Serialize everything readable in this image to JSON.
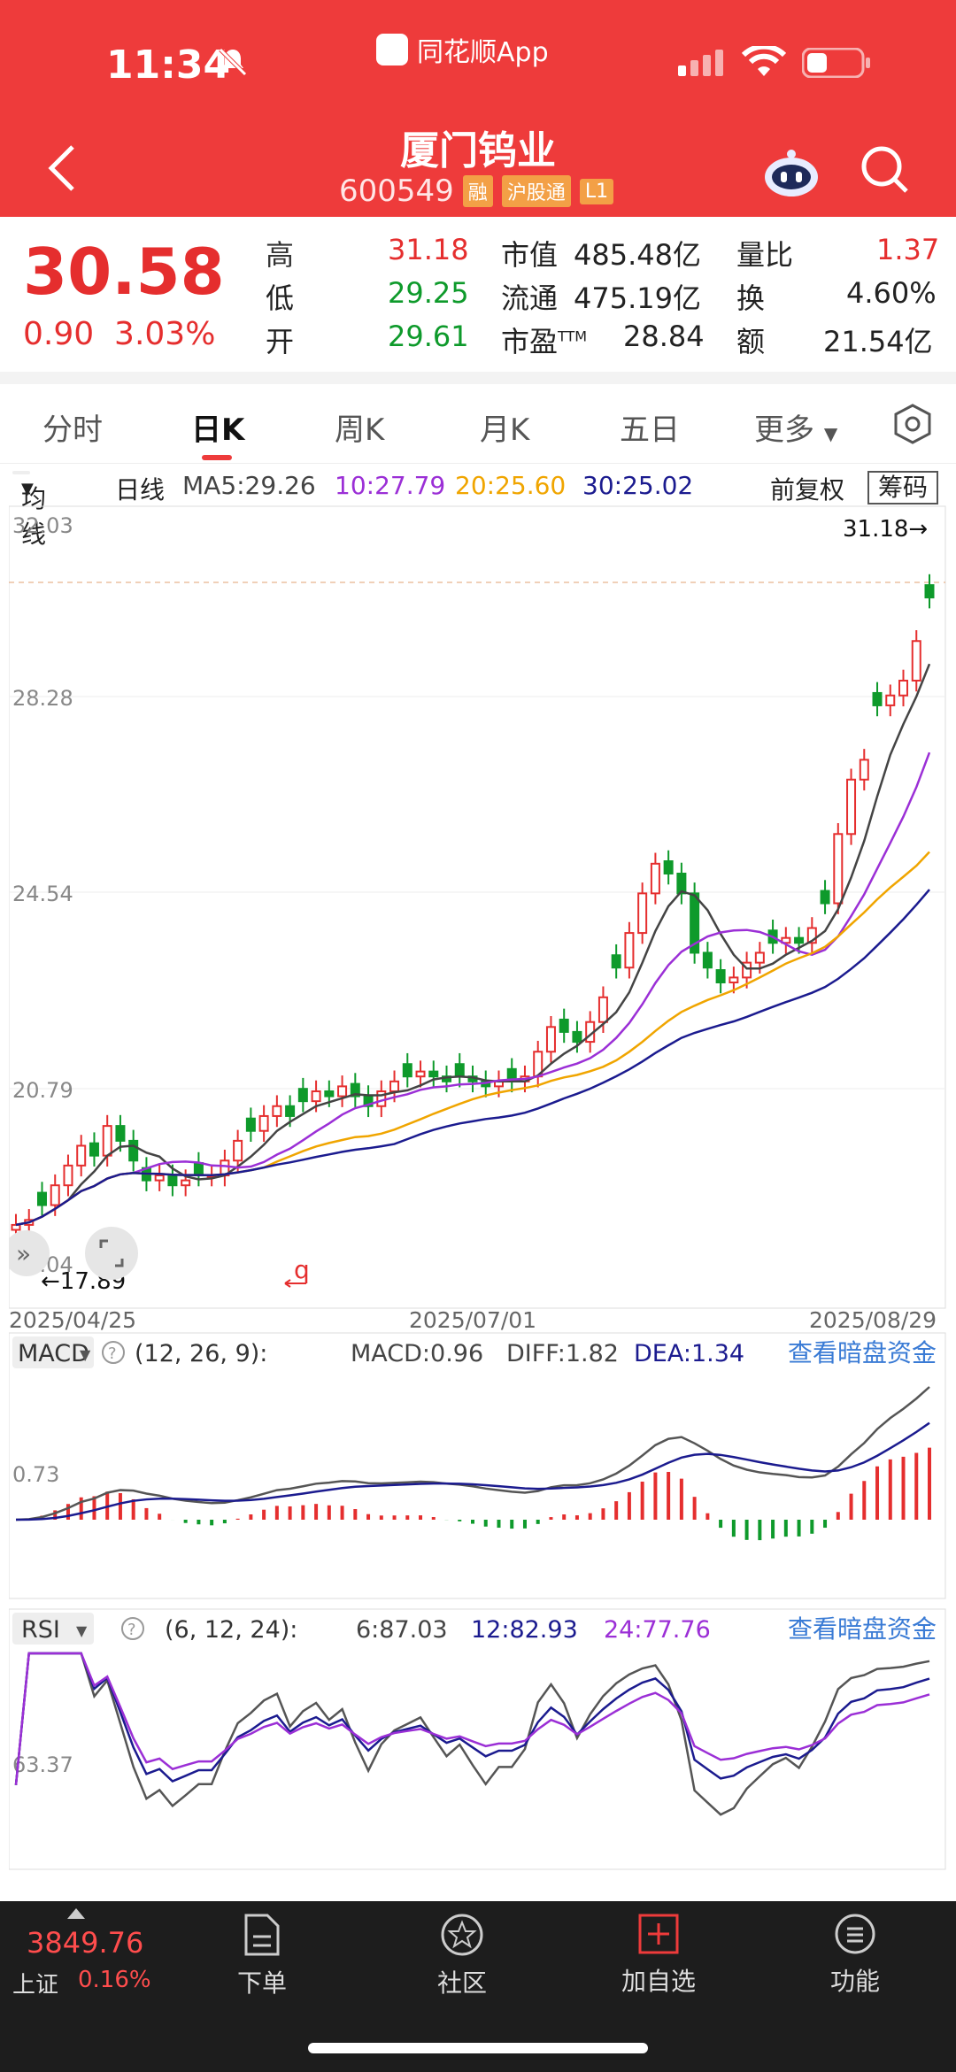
{
  "status": {
    "time": "11:34",
    "app": "同花顺App"
  },
  "header": {
    "title": "厦门钨业",
    "code": "600549",
    "tags": [
      "融",
      "沪股通",
      "L1"
    ]
  },
  "quote": {
    "price": "30.58",
    "change": "0.90",
    "change_pct": "3.03%",
    "rows": [
      {
        "label": "高",
        "value": "31.18",
        "color": "red"
      },
      {
        "label": "低",
        "value": "29.25",
        "color": "green"
      },
      {
        "label": "开",
        "value": "29.61",
        "color": "green"
      }
    ],
    "mid": [
      {
        "label": "市值",
        "value": "485.48亿"
      },
      {
        "label": "流通",
        "value": "475.19亿"
      },
      {
        "label": "市盈",
        "sup": "TTM",
        "value": "28.84"
      }
    ],
    "right": [
      {
        "label": "量比",
        "value": "1.37",
        "color": "red"
      },
      {
        "label": "换",
        "value": "4.60%"
      },
      {
        "label": "额",
        "value": "21.54亿"
      }
    ]
  },
  "tabs": [
    "分时",
    "日K",
    "周K",
    "月K",
    "五日",
    "更多"
  ],
  "ma_bar": {
    "selector": "均线",
    "period": "日线",
    "ma5": "MA5:29.26",
    "ma10": "10:27.79",
    "ma20": "20:25.60",
    "ma30": "30:25.02",
    "adjust": "前复权",
    "chip": "筹码"
  },
  "colors": {
    "red": "#e52e2e",
    "green": "#0e9a2b",
    "ma5": "#444444",
    "ma10": "#9b2fd6",
    "ma20": "#f0a500",
    "ma30": "#1b1b8f"
  },
  "chart_data": [
    {
      "type": "candlestick",
      "y_ticks": [
        "32.03",
        "28.28",
        "24.54",
        "20.79",
        "17.04"
      ],
      "ylim": [
        17.04,
        32.03
      ],
      "x_labels": [
        "2025/04/25",
        "2025/07/01",
        "2025/08/29"
      ],
      "high_marker": "31.18→",
      "low_marker": "←17.89",
      "closes": [
        17.9,
        18.0,
        18.3,
        18.7,
        19.1,
        19.5,
        19.3,
        19.9,
        19.6,
        19.2,
        18.8,
        18.9,
        18.7,
        18.8,
        18.9,
        18.9,
        19.2,
        19.6,
        19.8,
        20.1,
        20.3,
        20.1,
        20.4,
        20.6,
        20.5,
        20.7,
        20.5,
        20.3,
        20.6,
        20.8,
        20.9,
        21.0,
        20.9,
        20.8,
        20.9,
        20.8,
        20.7,
        20.8,
        20.8,
        20.9,
        21.4,
        21.9,
        21.8,
        21.6,
        22.0,
        22.5,
        23.1,
        23.8,
        24.6,
        25.2,
        25.0,
        24.6,
        23.4,
        23.1,
        22.8,
        22.9,
        23.2,
        23.4,
        23.6,
        23.7,
        23.6,
        23.9,
        24.4,
        25.8,
        26.9,
        27.3,
        28.4,
        28.6,
        28.9,
        29.7,
        30.58
      ],
      "series": [
        {
          "name": "MA5",
          "value": "29.26"
        },
        {
          "name": "MA10",
          "value": "27.79"
        },
        {
          "name": "MA20",
          "value": "25.60"
        },
        {
          "name": "MA30",
          "value": "25.02"
        }
      ]
    },
    {
      "type": "macd",
      "label": "MACD",
      "params": "(12, 26, 9):",
      "macd": "MACD:0.96",
      "diff": "DIFF:1.82",
      "dea": "DEA:1.34",
      "tick": "0.73",
      "link": "查看暗盘资金"
    },
    {
      "type": "rsi",
      "label": "RSI",
      "params": "(6, 12, 24):",
      "rsi6": "6:87.03",
      "rsi12": "12:82.93",
      "rsi24": "24:77.76",
      "tick": "63.37",
      "link": "查看暗盘资金"
    }
  ],
  "bottom": {
    "index_value": "3849.76",
    "index_name": "上证",
    "index_pct": "0.16%",
    "items": [
      "下单",
      "社区",
      "加自选",
      "功能"
    ]
  }
}
